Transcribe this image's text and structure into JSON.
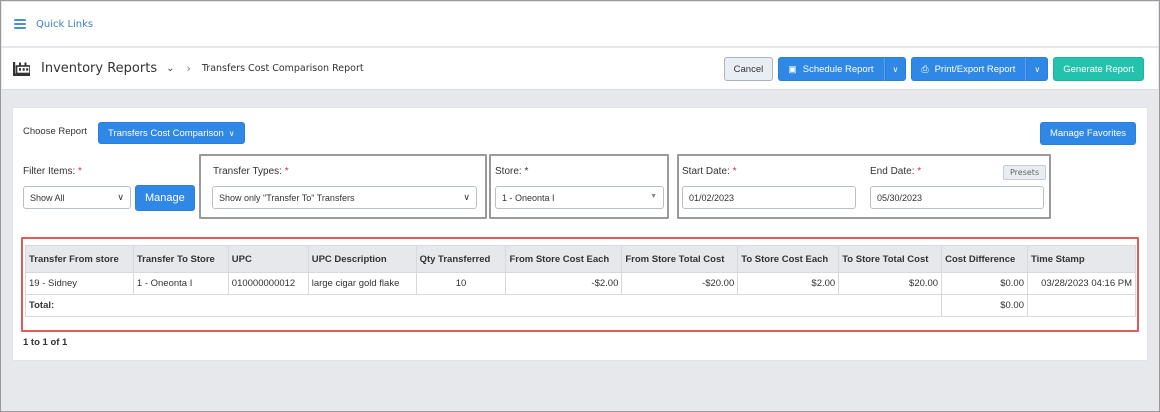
{
  "quick_links": {
    "label": "Quick Links"
  },
  "header": {
    "title": "Inventory Reports",
    "breadcrumb": "Transfers Cost Comparison Report",
    "buttons": {
      "cancel": "Cancel",
      "schedule": "Schedule Report",
      "print_export": "Print/Export Report",
      "generate": "Generate Report"
    }
  },
  "report": {
    "choose_label": "Choose Report",
    "selected": "Transfers Cost Comparison",
    "manage_favorites": "Manage Favorites"
  },
  "filters": {
    "filter_items": {
      "label": "Filter Items:",
      "required": "*",
      "value": "Show All",
      "manage": "Manage"
    },
    "transfer_types": {
      "label": "Transfer Types:",
      "required": "*",
      "value": "Show only \"Transfer To\" Transfers"
    },
    "store": {
      "label": "Store:",
      "required": "*",
      "value": "1 - Oneonta I"
    },
    "start_date": {
      "label": "Start Date:",
      "required": "*",
      "value": "01/02/2023"
    },
    "end_date": {
      "label": "End Date:",
      "required": "*",
      "value": "05/30/2023"
    },
    "presets": "Presets"
  },
  "table": {
    "columns": [
      "Transfer From store",
      "Transfer To Store",
      "UPC",
      "UPC Description",
      "Qty Transferred",
      "From Store Cost Each",
      "From Store Total Cost",
      "To Store Cost Each",
      "To Store Total Cost",
      "Cost Difference",
      "Time Stamp"
    ],
    "rows": [
      [
        "19 - Sidney",
        "1 - Oneonta I",
        "010000000012",
        "large cigar gold flake",
        "10",
        "-$2.00",
        "-$20.00",
        "$2.00",
        "$20.00",
        "$0.00",
        "03/28/2023 04:16 PM"
      ]
    ],
    "total": {
      "label": "Total:",
      "cost_difference": "$0.00"
    }
  },
  "pagination": {
    "text": "1 to 1 of 1"
  },
  "colors": {
    "primary": "#2f88e6",
    "teal": "#23c2ad",
    "highlight_red": "#e25a5a",
    "required": "#d6303a"
  }
}
